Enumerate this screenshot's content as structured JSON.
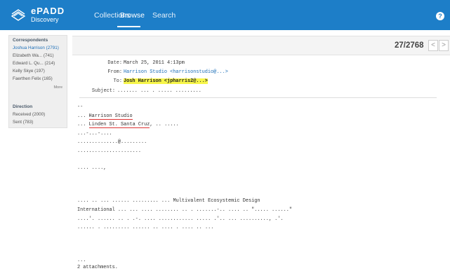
{
  "nav": {
    "logo_line1": "ePADD",
    "logo_line2": "Discovery",
    "collections": "Collections",
    "browse": "Browse",
    "search": "Search",
    "help": "?"
  },
  "sidebar": {
    "correspondents_title": "Correspondents",
    "correspondents": [
      "Joshua Harrison (2791)",
      "Elizabeth Wa... (741)",
      "Edward L. Qu... (214)",
      "Kelly Skye (197)",
      "Faerthen Felix (165)"
    ],
    "more": "More",
    "direction_title": "Direction",
    "direction": [
      "Received (2000)",
      "Sent (783)"
    ]
  },
  "pager": {
    "counter": "27/2768",
    "prev": "<",
    "next": ">"
  },
  "email": {
    "date_label": "Date:",
    "date_value": "March 25, 2011 4:13pm",
    "from_label": "From:",
    "from_value": "Harrison Studio <harrisonstudio@...>",
    "to_label": "To:",
    "to_value": "Josh Harrison <jpharris2@...>",
    "subject_label": "Subject:",
    "subject_value": "....... ... . ..... .........",
    "body": {
      "l1": "--",
      "l2_prefix": "... ",
      "l2_name": "Harrison Studio",
      "l3_prefix": "... ",
      "l3_addr": "Linden St. Santa Cruz",
      "l3_suffix": ", .. .....",
      "l4": "...-...-....",
      "l5": "..............@.........",
      "l6": "......................",
      "l7": ".... ....,",
      "l8": ".... .. ... ...... ......... ... Multivalent Ecosystemic Design",
      "l9": "International ... ... .... ........ .. . .......-.. .... .. \"..... ......\"",
      "l10": "....'. ...... .. . .-. .... ............ ..... .'.. ... .........., .'.",
      "l11": "...... . ......... ...... .. .... . .... .. ...",
      "l12": "...",
      "l13": "2 attachments."
    }
  }
}
